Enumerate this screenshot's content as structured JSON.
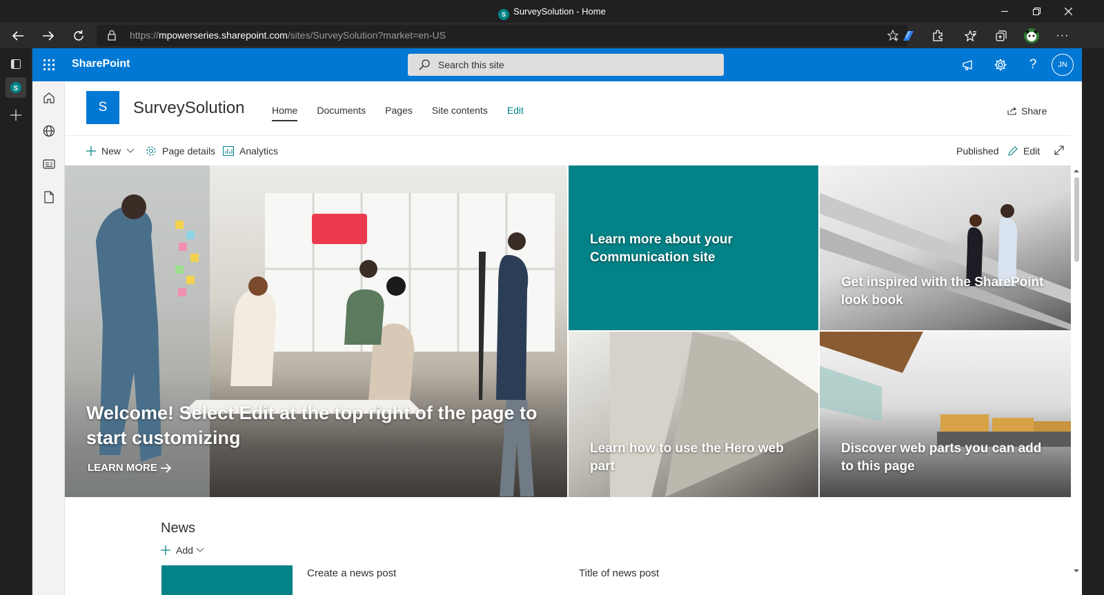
{
  "window": {
    "title": "SurveySolution - Home",
    "controls": [
      "minimize",
      "restore",
      "close"
    ]
  },
  "browser": {
    "url_prefix": "https://",
    "url_host": "mpowerseries.sharepoint.com",
    "url_path": "/sites/SurveySolution?market=en-US",
    "toolbar_icons": [
      "favorites-add-icon",
      "copilot-icon",
      "extensions-icon",
      "favorites-icon",
      "collections-icon",
      "profile-icon",
      "more-icon"
    ],
    "menu_more": "···"
  },
  "suitebar": {
    "brand": "SharePoint",
    "search_placeholder": "Search this site",
    "avatar_initials": "JN",
    "accent": "#0078d4"
  },
  "site": {
    "logo_letter": "S",
    "title": "SurveySolution",
    "nav": [
      {
        "label": "Home",
        "active": true
      },
      {
        "label": "Documents"
      },
      {
        "label": "Pages"
      },
      {
        "label": "Site contents"
      },
      {
        "label": "Edit"
      }
    ],
    "share_label": "Share"
  },
  "commandbar": {
    "new_label": "New",
    "page_details_label": "Page details",
    "analytics_label": "Analytics",
    "status_label": "Published",
    "edit_label": "Edit"
  },
  "hero": {
    "main_caption": "Welcome! Select Edit at the top right of the page to start customizing",
    "main_link": "LEARN MORE",
    "tiles": [
      {
        "caption": "Learn more about your Communication site",
        "color": "#038387"
      },
      {
        "caption": "Get inspired with the SharePoint look book"
      },
      {
        "caption": "Learn how to use the Hero web part"
      },
      {
        "caption": "Discover web parts you can add to this page"
      }
    ]
  },
  "news": {
    "heading": "News",
    "add_label": "Add",
    "items": [
      {
        "title": "Create a news post"
      },
      {
        "title": "Title of news post"
      }
    ]
  }
}
